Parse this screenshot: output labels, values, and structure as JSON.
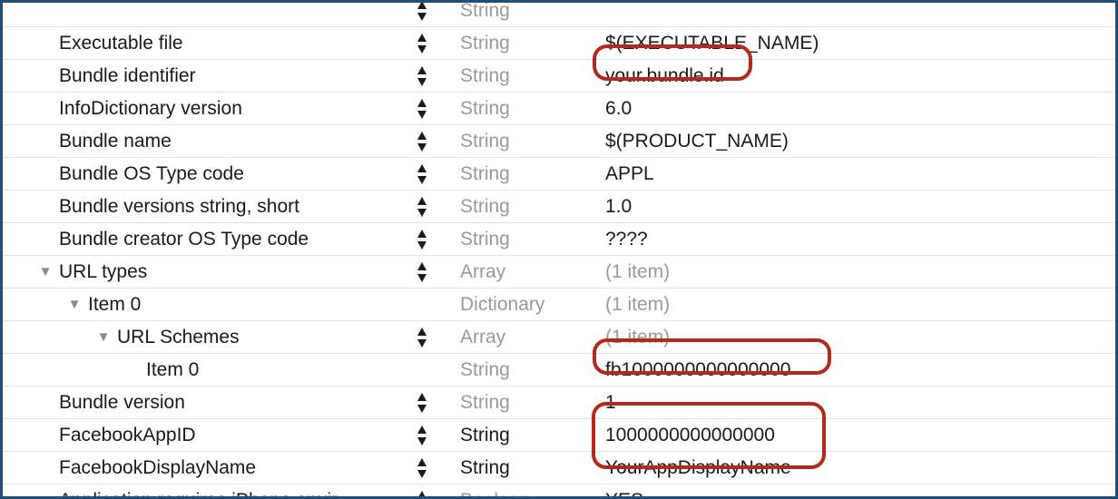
{
  "rows": [
    {
      "key": "",
      "type": "String",
      "value": "",
      "depth": 0,
      "triangle": false,
      "stepper": true,
      "type_strong": false,
      "value_muted": false
    },
    {
      "key": "Executable file",
      "type": "String",
      "value": "$(EXECUTABLE_NAME)",
      "depth": 0,
      "triangle": false,
      "stepper": true,
      "type_strong": false,
      "value_muted": false
    },
    {
      "key": "Bundle identifier",
      "type": "String",
      "value": "your.bundle.id",
      "depth": 0,
      "triangle": false,
      "stepper": true,
      "type_strong": false,
      "value_muted": false
    },
    {
      "key": "InfoDictionary version",
      "type": "String",
      "value": "6.0",
      "depth": 0,
      "triangle": false,
      "stepper": true,
      "type_strong": false,
      "value_muted": false
    },
    {
      "key": "Bundle name",
      "type": "String",
      "value": "$(PRODUCT_NAME)",
      "depth": 0,
      "triangle": false,
      "stepper": true,
      "type_strong": false,
      "value_muted": false
    },
    {
      "key": "Bundle OS Type code",
      "type": "String",
      "value": "APPL",
      "depth": 0,
      "triangle": false,
      "stepper": true,
      "type_strong": false,
      "value_muted": false
    },
    {
      "key": "Bundle versions string, short",
      "type": "String",
      "value": "1.0",
      "depth": 0,
      "triangle": false,
      "stepper": true,
      "type_strong": false,
      "value_muted": false
    },
    {
      "key": "Bundle creator OS Type code",
      "type": "String",
      "value": "????",
      "depth": 0,
      "triangle": false,
      "stepper": true,
      "type_strong": false,
      "value_muted": false
    },
    {
      "key": "URL types",
      "type": "Array",
      "value": "(1 item)",
      "depth": 0,
      "triangle": true,
      "stepper": true,
      "type_strong": false,
      "value_muted": true
    },
    {
      "key": "Item 0",
      "type": "Dictionary",
      "value": "(1 item)",
      "depth": 1,
      "triangle": true,
      "stepper": false,
      "type_strong": false,
      "value_muted": true
    },
    {
      "key": "URL Schemes",
      "type": "Array",
      "value": "(1 item)",
      "depth": 2,
      "triangle": true,
      "stepper": true,
      "type_strong": false,
      "value_muted": true
    },
    {
      "key": "Item 0",
      "type": "String",
      "value": "fb1000000000000000",
      "depth": 3,
      "triangle": false,
      "stepper": false,
      "type_strong": false,
      "value_muted": false
    },
    {
      "key": "Bundle version",
      "type": "String",
      "value": "1",
      "depth": 0,
      "triangle": false,
      "stepper": true,
      "type_strong": false,
      "value_muted": false
    },
    {
      "key": "FacebookAppID",
      "type": "String",
      "value": "1000000000000000",
      "depth": 0,
      "triangle": false,
      "stepper": true,
      "type_strong": true,
      "value_muted": false
    },
    {
      "key": "FacebookDisplayName",
      "type": "String",
      "value": "YourAppDisplayName",
      "depth": 0,
      "triangle": false,
      "stepper": true,
      "type_strong": true,
      "value_muted": false
    },
    {
      "key": "Application requires iPhone envir…",
      "type": "Boolean",
      "value": "YES",
      "depth": 0,
      "triangle": false,
      "stepper": true,
      "type_strong": false,
      "value_muted": false
    }
  ],
  "icons": {
    "disclosure": "disclosure-triangle-icon",
    "stepper": "up-down-stepper-icon"
  },
  "colors": {
    "frame_border": "#1f4e78",
    "highlight": "#b32a1c",
    "type_text": "#9a9a9a",
    "row_divider": "#e2e2e2"
  }
}
